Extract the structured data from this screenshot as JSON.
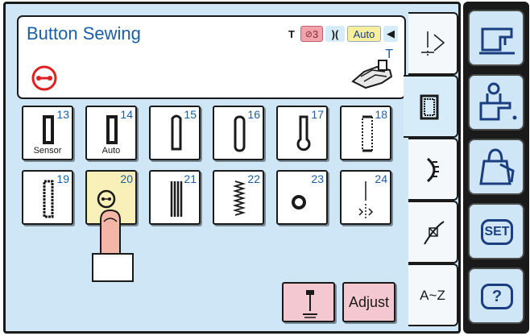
{
  "header": {
    "title": "Button Sewing",
    "status": {
      "thread_label": "T",
      "tension": "3",
      "feed": "Auto"
    },
    "presser_foot_letter": "T"
  },
  "stitches": [
    {
      "number": "13",
      "sub": "Sensor",
      "icon": "buttonhole-sensor-icon"
    },
    {
      "number": "14",
      "sub": "Auto",
      "icon": "buttonhole-auto-icon"
    },
    {
      "number": "15",
      "sub": "",
      "icon": "round-buttonhole-icon"
    },
    {
      "number": "16",
      "sub": "",
      "icon": "oval-buttonhole-icon"
    },
    {
      "number": "17",
      "sub": "",
      "icon": "keyhole-buttonhole-icon"
    },
    {
      "number": "18",
      "sub": "",
      "icon": "stretch-buttonhole-icon"
    },
    {
      "number": "19",
      "sub": "",
      "icon": "heirloom-buttonhole-icon"
    },
    {
      "number": "20",
      "sub": "",
      "icon": "button-sewing-icon"
    },
    {
      "number": "21",
      "sub": "",
      "icon": "bound-buttonhole-icon"
    },
    {
      "number": "22",
      "sub": "",
      "icon": "zigzag-buttonhole-icon"
    },
    {
      "number": "23",
      "sub": "",
      "icon": "eyelet-icon"
    },
    {
      "number": "24",
      "sub": "",
      "icon": "darning-icon"
    }
  ],
  "selected_stitch": "20",
  "buttons": {
    "adjust": "Adjust"
  },
  "tabs": [
    {
      "name": "utility-stitch-tab",
      "label": ""
    },
    {
      "name": "buttonhole-tab",
      "label": ""
    },
    {
      "name": "decorative-tab",
      "label": ""
    },
    {
      "name": "quilt-tab",
      "label": ""
    },
    {
      "name": "alphabet-tab",
      "label": "A~Z"
    }
  ],
  "right_panel": {
    "set_label": "SET",
    "help_label": "?"
  },
  "colors": {
    "accent_blue": "#1a5ea8",
    "screen_bg": "#cfe6f6",
    "selected_bg": "#f8f0b8",
    "pink": "#f4c8d0"
  }
}
